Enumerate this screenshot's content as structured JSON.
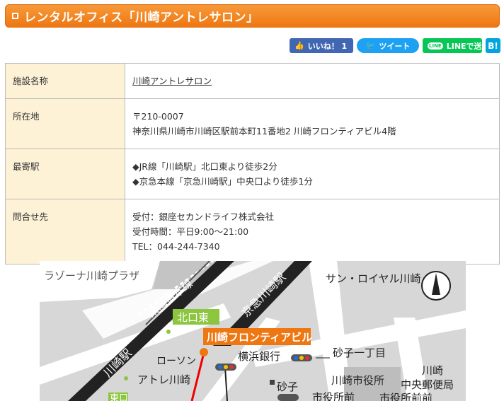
{
  "title": "レンタルオフィス「川崎アントレサロン」",
  "share": {
    "facebook": "いいね！ 1",
    "twitter": "ツイート",
    "line_icon": "LINE",
    "line": "LINEで送る",
    "hatena": "B!"
  },
  "table": {
    "rows": [
      {
        "label": "施設名称",
        "lines": [
          "川崎アントレサロン"
        ]
      },
      {
        "label": "所在地",
        "lines": [
          "〒210-0007",
          "神奈川県川崎市川崎区駅前本町11番地2 川崎フロンティアビル4階"
        ]
      },
      {
        "label": "最寄駅",
        "lines": [
          "◆JR線「川崎駅」北口東より徒歩2分",
          "◆京急本線「京急川崎駅」中央口より徒歩1分"
        ]
      },
      {
        "label": "問合せ先",
        "lines": [
          "受付：銀座セカンドライフ株式会社",
          "受付時間：平日9:00〜21:00",
          "TEL：044-244-7340"
        ]
      }
    ]
  },
  "map": {
    "labels": {
      "lazona": "ラゾーナ川崎プラザ",
      "tokaido": "東海道本線",
      "keikyu": "京急川崎駅",
      "sun_royal": "サン・ロイヤル川崎",
      "kitaguchi_higashi": "北口東",
      "frontier": "川崎フロンティアビル",
      "kawasaki_station": "川崎駅",
      "lawson": "ローソン",
      "yokohama_bank": "横浜銀行",
      "sunago1": "砂子一丁目",
      "atre": "アトレ川崎",
      "city_hall": "川崎市役所",
      "kawasaki": "川崎",
      "post_office": "中央郵便局",
      "sunago": "砂子",
      "city_hall_front": "市役所前",
      "east_exit": "東口",
      "sunago_front": "市役所前前"
    }
  }
}
